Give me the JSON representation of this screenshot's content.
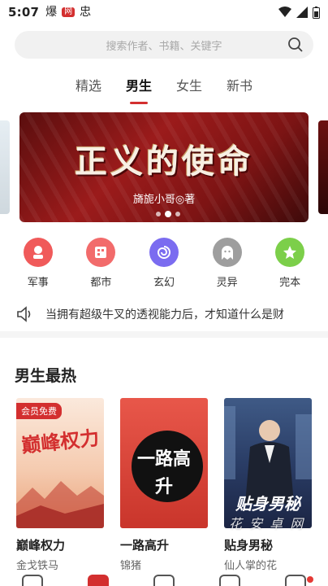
{
  "status_bar": {
    "time": "5:07",
    "icons": [
      "flame-icon",
      "app-badge-icon",
      "bug-icon"
    ]
  },
  "search": {
    "placeholder": "搜索作者、书籍、关键字"
  },
  "tabs": [
    {
      "label": "精选"
    },
    {
      "label": "男生"
    },
    {
      "label": "女生"
    },
    {
      "label": "新书"
    }
  ],
  "banner": {
    "title": "正义的使命",
    "author": "旖旎小哥◎著"
  },
  "categories": [
    {
      "label": "军事",
      "color": "#f05a5a",
      "icon": "soldier-icon"
    },
    {
      "label": "都市",
      "color": "#f26b6b",
      "icon": "city-icon"
    },
    {
      "label": "玄幻",
      "color": "#7b6cf0",
      "icon": "swirl-icon"
    },
    {
      "label": "灵异",
      "color": "#9e9e9e",
      "icon": "ghost-icon"
    },
    {
      "label": "完本",
      "color": "#7ccf4a",
      "icon": "star-icon"
    }
  ],
  "notice": {
    "text": "当拥有超级牛叉的透视能力后，才知道什么是财"
  },
  "section": {
    "title": "男生最热",
    "books": [
      {
        "name": "巅峰权力",
        "author": "金戈铁马",
        "badge": "会员免费",
        "cover_title": "巅峰权力"
      },
      {
        "name": "一路高升",
        "author": "锦猪",
        "cover_title": "一路高升"
      },
      {
        "name": "贴身男秘",
        "author": "仙人掌的花",
        "cover_title": "贴身男秘"
      }
    ]
  },
  "watermark": "花 安 卓 网"
}
